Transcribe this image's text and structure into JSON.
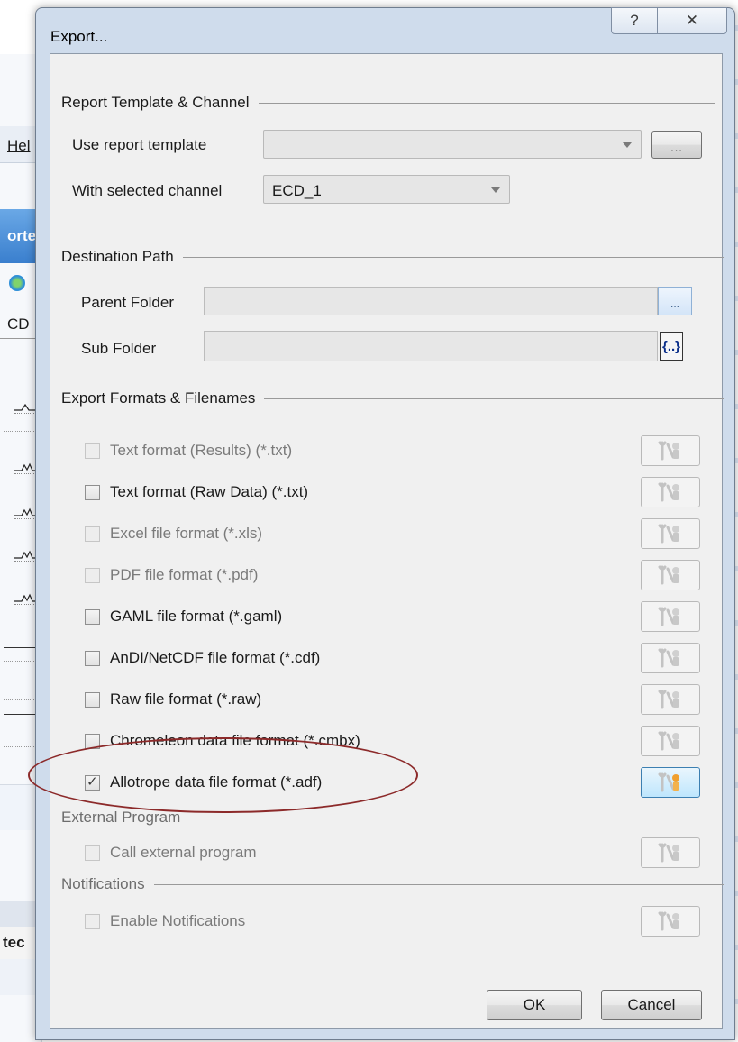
{
  "background": {
    "menu_fragment": "Hel",
    "tab_fragment": "orte",
    "channel_fragment": "CD",
    "bottom_fragment": "tec"
  },
  "dialog": {
    "title": "Export...",
    "help_glyph": "?",
    "close_glyph": "✕",
    "sections": {
      "template": "Report Template & Channel",
      "destination": "Destination Path",
      "formats": "Export Formats & Filenames",
      "external": "External Program",
      "notifications": "Notifications"
    },
    "template": {
      "use_label": "Use report template",
      "use_value": "",
      "browse_label": "...",
      "channel_label": "With selected channel",
      "channel_value": "ECD_1"
    },
    "destination": {
      "parent_label": "Parent Folder",
      "parent_value": "",
      "parent_browse": "...",
      "sub_label": "Sub Folder",
      "sub_value": "",
      "sub_browse": "{..}"
    },
    "formats": [
      {
        "label": "Text format (Results) (*.txt)",
        "checked": false,
        "enabled": false
      },
      {
        "label": "Text format (Raw Data) (*.txt)",
        "checked": false,
        "enabled": true
      },
      {
        "label": "Excel file format (*.xls)",
        "checked": false,
        "enabled": false
      },
      {
        "label": "PDF file format (*.pdf)",
        "checked": false,
        "enabled": false
      },
      {
        "label": "GAML file format (*.gaml)",
        "checked": false,
        "enabled": true
      },
      {
        "label": "AnDI/NetCDF file format (*.cdf)",
        "checked": false,
        "enabled": true
      },
      {
        "label": "Raw file format (*.raw)",
        "checked": false,
        "enabled": true
      },
      {
        "label": "Chromeleon data file format (*.cmbx)",
        "checked": false,
        "enabled": true
      },
      {
        "label": "Allotrope data file format (*.adf)",
        "checked": true,
        "enabled": true
      }
    ],
    "external": {
      "label": "Call external program",
      "checked": false,
      "enabled": false
    },
    "notifications": {
      "label": "Enable Notifications",
      "checked": false,
      "enabled": false
    },
    "ok_label": "OK",
    "cancel_label": "Cancel",
    "highlight_color": "#8c2a2a"
  }
}
